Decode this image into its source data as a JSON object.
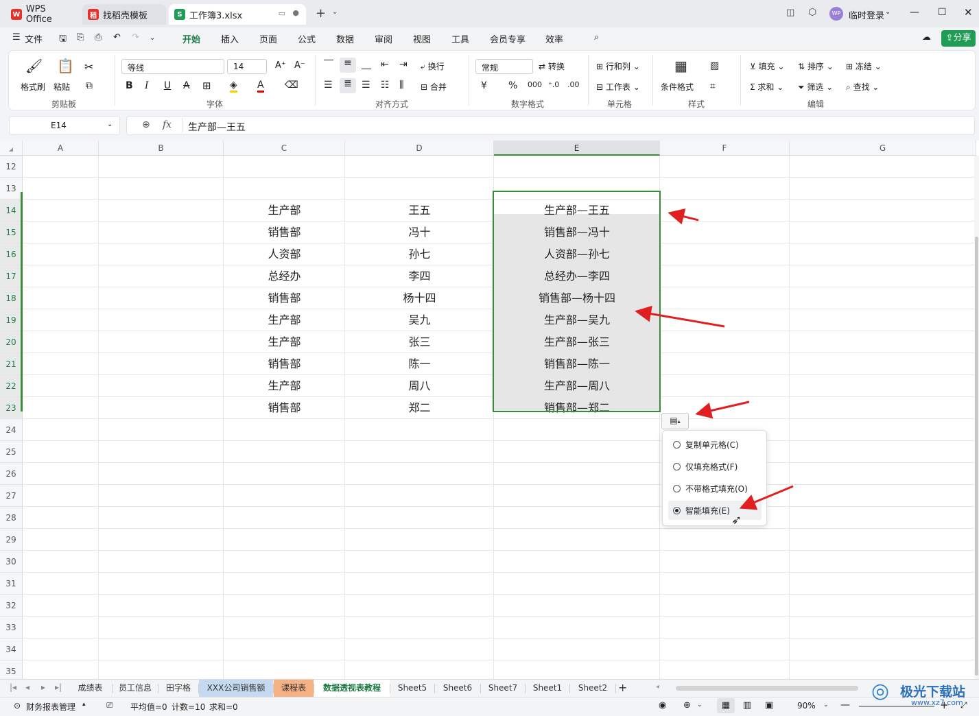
{
  "titlebar": {
    "tabs": [
      {
        "label": "WPS Office",
        "icon": "wps-logo-icon"
      },
      {
        "label": "找稻壳模板",
        "icon": "daoke-icon"
      },
      {
        "label": "工作簿3.xlsx",
        "icon": "spreadsheet-s-icon"
      }
    ],
    "login_label": "临时登录",
    "avatar_text": "WP"
  },
  "menubar": {
    "file_label": "文件",
    "tabs": [
      "开始",
      "插入",
      "页面",
      "公式",
      "数据",
      "审阅",
      "视图",
      "工具",
      "会员专享",
      "效率"
    ],
    "active_tab": "开始",
    "share_label": "分享"
  },
  "ribbon": {
    "clipboard": {
      "format_painter": "格式刷",
      "paste": "粘贴",
      "group": "剪贴板"
    },
    "font": {
      "name": "等线",
      "size": "14",
      "group": "字体",
      "bold": "B",
      "italic": "I",
      "underline": "U",
      "strike": "A",
      "font_color": "A",
      "grow": "A⁺",
      "shrink": "A⁻"
    },
    "align": {
      "wrap": "换行",
      "merge": "合并",
      "group": "对齐方式"
    },
    "number": {
      "format": "常规",
      "convert": "转换",
      "group": "数字格式",
      "currency": "¥",
      "percent": "%"
    },
    "cells": {
      "rowcol": "行和列",
      "worksheet": "工作表",
      "group": "单元格"
    },
    "styles": {
      "cond_format": "条件格式",
      "group": "样式"
    },
    "edit": {
      "fill": "填充",
      "sort": "排序",
      "freeze": "冻结",
      "sum": "求和",
      "filter": "筛选",
      "find": "查找",
      "group": "编辑"
    }
  },
  "formula": {
    "cell_ref": "E14",
    "fx": "fx",
    "value": "生产部—王五"
  },
  "columns": [
    "A",
    "B",
    "C",
    "D",
    "E",
    "F",
    "G"
  ],
  "rows": [
    "12",
    "13",
    "14",
    "15",
    "16",
    "17",
    "18",
    "19",
    "20",
    "21",
    "22",
    "23",
    "24",
    "25",
    "26",
    "27",
    "28",
    "29",
    "30",
    "31",
    "32",
    "33",
    "34",
    "35"
  ],
  "data_rows": [
    {
      "row": "14",
      "c": "生产部",
      "d": "王五",
      "e": "生产部—王五"
    },
    {
      "row": "15",
      "c": "销售部",
      "d": "冯十",
      "e": "销售部—冯十"
    },
    {
      "row": "16",
      "c": "人资部",
      "d": "孙七",
      "e": "人资部—孙七"
    },
    {
      "row": "17",
      "c": "总经办",
      "d": "李四",
      "e": "总经办—李四"
    },
    {
      "row": "18",
      "c": "销售部",
      "d": "杨十四",
      "e": "销售部—杨十四"
    },
    {
      "row": "19",
      "c": "生产部",
      "d": "吴九",
      "e": "生产部—吴九"
    },
    {
      "row": "20",
      "c": "生产部",
      "d": "张三",
      "e": "生产部—张三"
    },
    {
      "row": "21",
      "c": "销售部",
      "d": "陈一",
      "e": "销售部—陈一"
    },
    {
      "row": "22",
      "c": "生产部",
      "d": "周八",
      "e": "生产部—周八"
    },
    {
      "row": "23",
      "c": "销售部",
      "d": "郑二",
      "e": "销售部—郑二"
    }
  ],
  "fill_menu": {
    "options": [
      {
        "label": "复制单元格(C)",
        "selected": false
      },
      {
        "label": "仅填充格式(F)",
        "selected": false
      },
      {
        "label": "不带格式填充(O)",
        "selected": false
      },
      {
        "label": "智能填充(E)",
        "selected": true
      }
    ]
  },
  "sheets": [
    {
      "label": "成绩表",
      "color": ""
    },
    {
      "label": "员工信息",
      "color": ""
    },
    {
      "label": "田字格",
      "color": ""
    },
    {
      "label": "XXX公司销售额",
      "color": "#c5d9f1"
    },
    {
      "label": "课程表",
      "color": "#f4b183"
    },
    {
      "label": "数据透视表教程",
      "color": "#ffffff",
      "active": true
    },
    {
      "label": "Sheet5",
      "color": ""
    },
    {
      "label": "Sheet6",
      "color": ""
    },
    {
      "label": "Sheet7",
      "color": ""
    },
    {
      "label": "Sheet1",
      "color": ""
    },
    {
      "label": "Sheet2",
      "color": ""
    }
  ],
  "status": {
    "macro": "财务报表管理",
    "average": "平均值=0",
    "count": "计数=10",
    "sum": "求和=0",
    "zoom": "90%"
  },
  "watermark": {
    "text": "极光下载站",
    "url": "www.xz7.com"
  },
  "colors": {
    "accent": "#1f7a44",
    "selection": "#3a8a3a",
    "arrow": "#e02020"
  }
}
